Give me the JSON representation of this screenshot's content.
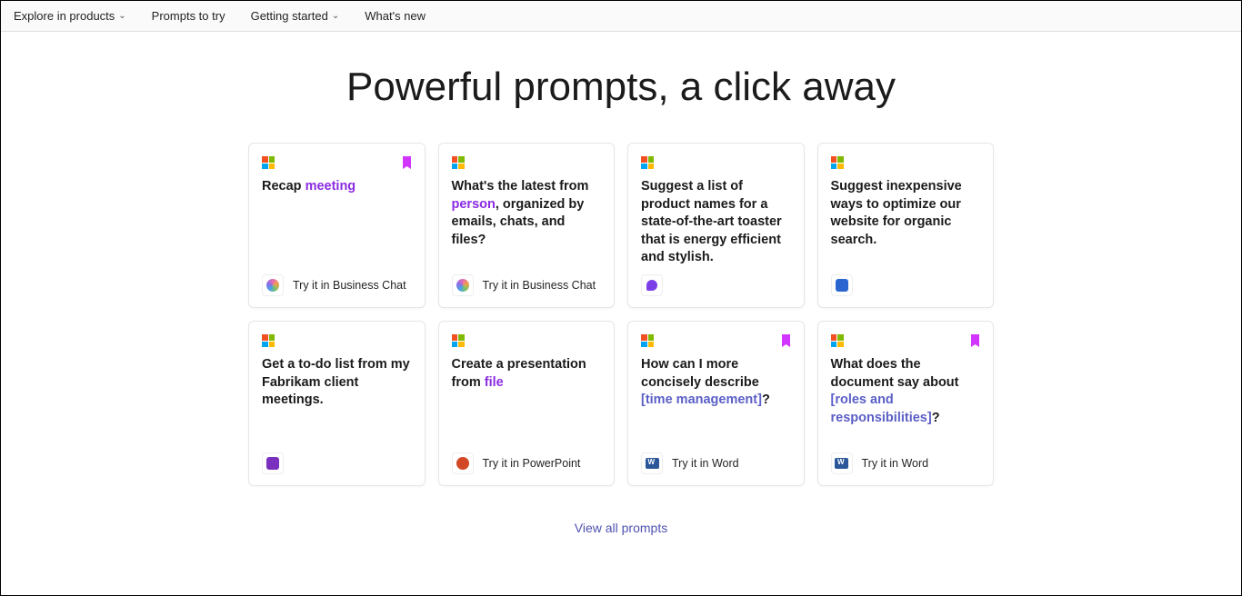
{
  "nav": {
    "explore": "Explore in products",
    "prompts": "Prompts to try",
    "getting_started": "Getting started",
    "whats_new": "What's new"
  },
  "title": "Powerful prompts, a click away",
  "cards": [
    {
      "pre": "Recap ",
      "hl": "meeting",
      "post": "",
      "try": "Try it in Business Chat",
      "icon": "chat",
      "bookmarked": true
    },
    {
      "pre": "What's the latest from ",
      "hl": "person",
      "post": ", organized by emails, chats, and files?",
      "try": "Try it in Business Chat",
      "icon": "chat",
      "bookmarked": false
    },
    {
      "pre": "Suggest a list of product names for a state-of-the-art toaster that is energy efficient and stylish.",
      "hl": "",
      "post": "",
      "try": "",
      "icon": "loop",
      "bookmarked": false
    },
    {
      "pre": "Suggest inexpensive ways to optimize our website for organic search.",
      "hl": "",
      "post": "",
      "try": "",
      "icon": "wb",
      "bookmarked": false
    },
    {
      "pre": "Get a to-do list from my Fabrikam client meetings.",
      "hl": "",
      "post": "",
      "try": "",
      "icon": "note",
      "bookmarked": false
    },
    {
      "pre": "Create a presentation from ",
      "hl": "file",
      "post": "",
      "try": "Try it in PowerPoint",
      "icon": "ppt",
      "bookmarked": false
    },
    {
      "pre": "How can I more concisely describe ",
      "hl": "[time management]",
      "post": "?",
      "try": "Try it in Word",
      "icon": "word",
      "bookmarked": true,
      "hlblue": true
    },
    {
      "pre": "What does the document say about ",
      "hl": "[roles and responsibilities]",
      "post": "?",
      "try": "Try it in Word",
      "icon": "word",
      "bookmarked": true,
      "hlblue": true
    }
  ],
  "view_all": "View all prompts"
}
